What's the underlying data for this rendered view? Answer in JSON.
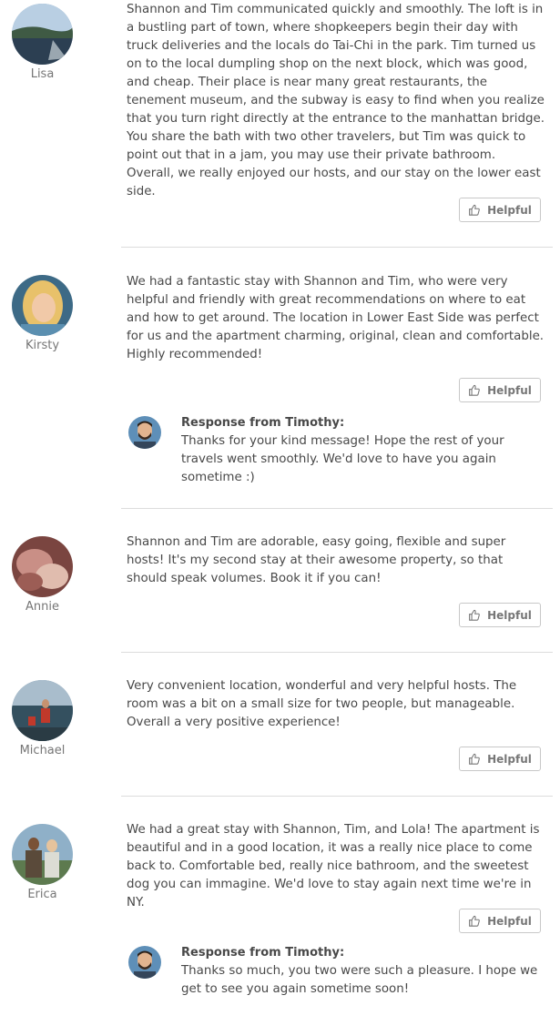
{
  "reviews": [
    {
      "name": "Lisa",
      "text": "Shannon and Tim communicated quickly and smoothly. The loft is in a bustling part of town, where shopkeepers begin their day with truck deliveries and the locals do Tai-Chi in the park. Tim turned us on to the local dumpling shop on the next block, which was good, and cheap. Their place is near many great restaurants, the tenement museum, and the subway is easy to find when you realize that you turn right directly at the entrance to the manhattan bridge. You share the bath with two other travelers, but Tim was quick to point out that in a jam, you may use their private bathroom. Overall, we really enjoyed our hosts, and our stay on the lower east side.",
      "helpful_label": "Helpful"
    },
    {
      "name": "Kirsty",
      "text": "We had a fantastic stay with Shannon and Tim, who were very helpful and friendly with great recommendations on where to eat and how to get around. The location in Lower East Side was perfect for us and the apartment charming, original, clean and comfortable. Highly recommended!",
      "helpful_label": "Helpful",
      "response": {
        "title": "Response from Timothy:",
        "text": "Thanks for your kind message! Hope the rest of your travels went smoothly. We'd love to have you again sometime :)"
      }
    },
    {
      "name": "Annie",
      "text": "Shannon and Tim are adorable, easy going, flexible and super hosts! It's my second stay at their awesome property, so that should speak volumes. Book it if you can!",
      "helpful_label": "Helpful"
    },
    {
      "name": "Michael",
      "text": "Very convenient location, wonderful and very helpful hosts. The room was a bit on a small size for two people, but manageable. Overall a very positive experience!",
      "helpful_label": "Helpful"
    },
    {
      "name": "Erica",
      "text": "We had a great stay with Shannon, Tim, and Lola! The apartment is beautiful and in a good location, it was a really nice place to come back to. Comfortable bed, really nice bathroom, and the sweetest dog you can immagine. We'd love to stay again next time we're in NY.",
      "helpful_label": "Helpful",
      "response": {
        "title": "Response from Timothy:",
        "text": "Thanks so much, you two were such a pleasure. I hope we get to see you again sometime soon!"
      }
    }
  ],
  "icons": {
    "helpful": "thumbs-up-icon"
  },
  "colors": {
    "text": "#484848",
    "muted": "#767676",
    "border": "#c8c8c8",
    "divider": "#dcdcdc"
  }
}
